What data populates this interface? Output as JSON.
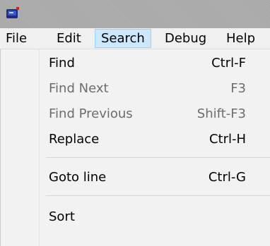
{
  "menubar": {
    "items": [
      {
        "label": "File"
      },
      {
        "label": "Edit"
      },
      {
        "label": "Search"
      },
      {
        "label": "Debug"
      },
      {
        "label": "Help"
      }
    ]
  },
  "search_menu": {
    "items": [
      {
        "label": "Find",
        "shortcut": "Ctrl-F",
        "enabled": true
      },
      {
        "label": "Find Next",
        "shortcut": "F3",
        "enabled": false
      },
      {
        "label": "Find Previous",
        "shortcut": "Shift-F3",
        "enabled": false
      },
      {
        "label": "Replace",
        "shortcut": "Ctrl-H",
        "enabled": true
      },
      {
        "label": "Goto line",
        "shortcut": "Ctrl-G",
        "enabled": true
      },
      {
        "label": "Sort",
        "shortcut": "",
        "enabled": true
      }
    ]
  },
  "colors": {
    "active_menu_bg": "#cce8ff",
    "active_menu_border": "#99d1ff",
    "disabled_text": "#6d6d6d"
  },
  "icons": {
    "app": "app-icon"
  }
}
